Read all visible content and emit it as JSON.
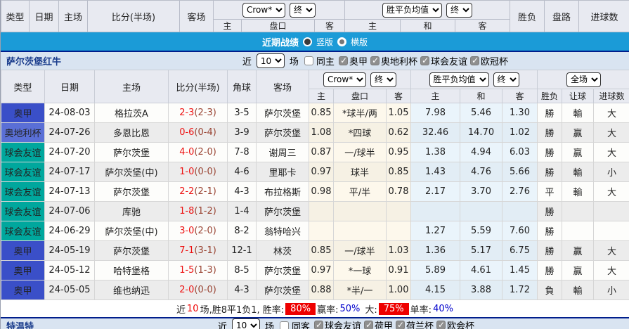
{
  "palette": {
    "奥甲": "#3a4fc8",
    "奥地利杯": "#5a6fd6",
    "球会友谊": "#00a79d",
    "title_bar_blue": "#1b9bd7",
    "navy_border": "#001e8c",
    "section_bg": "#d9e4f1",
    "header_bg": "#e8eaf1",
    "odds_cream": "#fdf8ec",
    "avg_pale_blue": "#eaf4fb",
    "team_green": "#009933",
    "score_red": "#ee1111",
    "rate_badge_red": "#ee0000",
    "rate_blue": "#0000cc"
  },
  "color_map": {
    "勝": "t-red",
    "平": "t-blue",
    "負": "t-green",
    "輸": "t-green",
    "贏": "t-red",
    "大": "t-red",
    "小": "t-green"
  },
  "top_header": {
    "type": "类型",
    "date": "日期",
    "home": "主场",
    "score": "比分(半场)",
    "away": "客场",
    "bookmaker": "Crow*",
    "final1": "终",
    "odds_home": "主",
    "handicap": "盘口",
    "odds_away": "客",
    "avg": "胜平负均值",
    "final2": "终",
    "avg_home": "主",
    "avg_draw": "和",
    "avg_away": "客",
    "result": "胜负",
    "trend": "盘路",
    "goals": "进球数"
  },
  "title_bar": {
    "title": "近期战绩",
    "option_vertical": "竖版",
    "option_horizontal": "横版"
  },
  "team_section": {
    "team": "萨尔茨堡红牛",
    "near": "近",
    "count": "10",
    "games": "场",
    "same": "同主",
    "filters": [
      "奥甲",
      "奥地利杯",
      "球会友谊",
      "欧冠杯"
    ]
  },
  "match_table": {
    "header": {
      "type": "类型",
      "date": "日期",
      "home": "主场",
      "score": "比分(半场)",
      "corners": "角球",
      "away": "客场",
      "bookmaker": "Crow*",
      "final1": "终",
      "odds_home": "主",
      "handicap": "盘口",
      "odds_away": "客",
      "avg": "胜平负均值",
      "final2": "终",
      "avg_home": "主",
      "avg_draw": "和",
      "avg_away": "客",
      "result": "胜负",
      "handicap_result": "让球",
      "goals": "进球数",
      "fulltime": "全场"
    },
    "rows": [
      {
        "type": "奥甲",
        "date": "24-08-03",
        "home": "格拉茨A",
        "home_green": false,
        "score": "2-3",
        "half": "(2-3)",
        "corners": "3-5",
        "away": "萨尔茨堡",
        "away_green": true,
        "odds_home": "0.85",
        "handicap": "*球半/两",
        "handicap_color": "red",
        "odds_away": "1.05",
        "avg_home": "7.98",
        "avg_draw": "5.46",
        "avg_away": "1.30",
        "result": "勝",
        "trend": "輸",
        "goals": "大"
      },
      {
        "type": "奥地利杯",
        "date": "24-07-26",
        "home": "多恩比恩",
        "home_green": false,
        "score": "0-6",
        "half": "(0-4)",
        "corners": "3-9",
        "away": "萨尔茨堡",
        "away_green": true,
        "odds_home": "1.08",
        "handicap": "*四球",
        "handicap_color": "red",
        "odds_away": "0.62",
        "avg_home": "32.46",
        "avg_draw": "14.70",
        "avg_away": "1.02",
        "result": "勝",
        "trend": "贏",
        "goals": "大"
      },
      {
        "type": "球会友谊",
        "date": "24-07-20",
        "home": "萨尔茨堡",
        "home_green": true,
        "score": "4-0",
        "half": "(2-0)",
        "corners": "7-8",
        "away": "谢周三",
        "away_green": false,
        "odds_home": "0.87",
        "handicap": "一/球半",
        "handicap_color": "red",
        "odds_away": "0.95",
        "avg_home": "1.38",
        "avg_draw": "4.94",
        "avg_away": "6.03",
        "result": "勝",
        "trend": "贏",
        "goals": "大"
      },
      {
        "type": "球会友谊",
        "date": "24-07-17",
        "home": "萨尔茨堡(中)",
        "home_green": true,
        "score": "1-0",
        "half": "(0-0)",
        "corners": "4-6",
        "away": "里耶卡",
        "away_green": false,
        "odds_home": "0.97",
        "handicap": "球半",
        "handicap_color": "red",
        "odds_away": "0.85",
        "avg_home": "1.43",
        "avg_draw": "4.76",
        "avg_away": "5.66",
        "result": "勝",
        "trend": "輸",
        "goals": "小"
      },
      {
        "type": "球会友谊",
        "date": "24-07-13",
        "home": "萨尔茨堡",
        "home_green": true,
        "score": "2-2",
        "half": "(2-1)",
        "corners": "4-3",
        "away": "布拉格斯",
        "away_green": false,
        "odds_home": "0.98",
        "handicap": "平/半",
        "handicap_color": "red",
        "odds_away": "0.78",
        "avg_home": "2.17",
        "avg_draw": "3.70",
        "avg_away": "2.76",
        "result": "平",
        "trend": "輸",
        "goals": "大"
      },
      {
        "type": "球会友谊",
        "date": "24-07-06",
        "home": "库驰",
        "home_green": false,
        "score": "1-8",
        "half": "(1-2)",
        "corners": "1-4",
        "away": "萨尔茨堡",
        "away_green": true,
        "odds_home": "",
        "handicap": "",
        "handicap_color": "",
        "odds_away": "",
        "avg_home": "",
        "avg_draw": "",
        "avg_away": "",
        "result": "勝",
        "trend": "",
        "goals": ""
      },
      {
        "type": "球会友谊",
        "date": "24-06-29",
        "home": "萨尔茨堡(中)",
        "home_green": true,
        "score": "3-0",
        "half": "(2-0)",
        "corners": "8-2",
        "away": "翁特哈兴",
        "away_green": false,
        "odds_home": "",
        "handicap": "",
        "handicap_color": "",
        "odds_away": "",
        "avg_home": "1.27",
        "avg_draw": "5.59",
        "avg_away": "7.60",
        "result": "勝",
        "trend": "",
        "goals": ""
      },
      {
        "type": "奥甲",
        "date": "24-05-19",
        "home": "萨尔茨堡",
        "home_green": true,
        "score": "7-1",
        "half": "(3-1)",
        "corners": "12-1",
        "away": "林茨",
        "away_green": false,
        "odds_home": "0.85",
        "handicap": "一/球半",
        "handicap_color": "blue",
        "odds_away": "1.03",
        "avg_home": "1.36",
        "avg_draw": "5.17",
        "avg_away": "6.75",
        "result": "勝",
        "trend": "贏",
        "goals": "大"
      },
      {
        "type": "奥甲",
        "date": "24-05-12",
        "home": "哈特堡格",
        "home_green": false,
        "score": "1-5",
        "half": "(1-3)",
        "corners": "8-5",
        "away": "萨尔茨堡",
        "away_green": true,
        "odds_home": "0.97",
        "handicap": "*一球",
        "handicap_color": "red",
        "odds_away": "0.91",
        "avg_home": "5.89",
        "avg_draw": "4.61",
        "avg_away": "1.45",
        "result": "勝",
        "trend": "贏",
        "goals": "大"
      },
      {
        "type": "奥甲",
        "date": "24-05-05",
        "home": "维也纳迅",
        "home_green": false,
        "score": "2-0",
        "half": "(0-0)",
        "corners": "4-3",
        "away": "萨尔茨堡",
        "away_green": true,
        "odds_home": "0.88",
        "handicap": "*半/一",
        "handicap_color": "red",
        "odds_away": "1.00",
        "avg_home": "4.15",
        "avg_draw": "3.88",
        "avg_away": "1.72",
        "result": "負",
        "trend": "輸",
        "goals": "小"
      }
    ]
  },
  "summary": {
    "near": "近",
    "count": "10",
    "text1": "场,胜8平1负1, 胜率:",
    "win_rate": "80%",
    "label_win": "赢率:",
    "win_value": "50%",
    "label_big": "大:",
    "big_value": "75%",
    "label_single": "单率:",
    "single_value": "40%"
  },
  "next_section": {
    "team": "特温特",
    "near": "近",
    "count": "10",
    "games": "场",
    "same": "同客",
    "filters": [
      "球会友谊",
      "荷甲",
      "荷兰杯",
      "欧会杯"
    ]
  }
}
